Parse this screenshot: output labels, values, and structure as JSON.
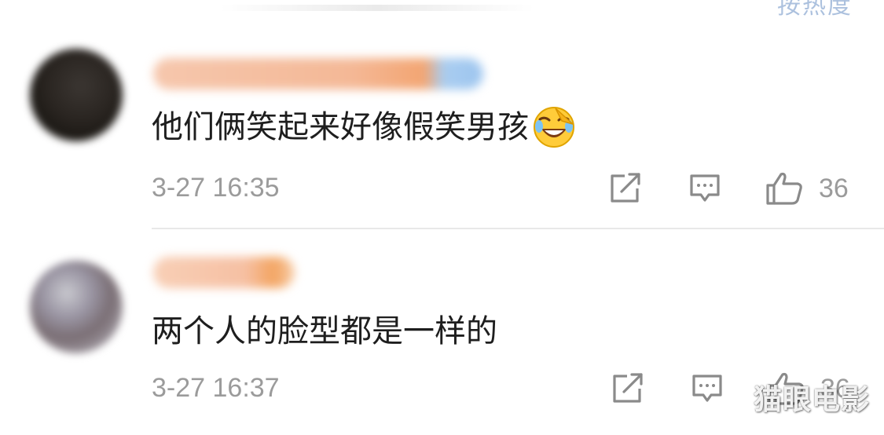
{
  "header": {
    "cut_text": "按热度"
  },
  "comments": [
    {
      "text": "他们俩笑起来好像假笑男孩",
      "emoji": "laughing-crying-emoji",
      "timestamp": "3-27 16:35",
      "likes": "36"
    },
    {
      "text": "两个人的脸型都是一样的",
      "timestamp": "3-27 16:37",
      "likes": "36"
    }
  ],
  "icons": {
    "share": "share-icon",
    "reply": "comment-icon",
    "like": "thumbs-up-icon"
  },
  "colors": {
    "text": "#1e1e1e",
    "meta": "#9b9b9b",
    "divider": "#e8e8e8",
    "header_accent": "#6a8fc4"
  },
  "watermark": "猫眼电影"
}
